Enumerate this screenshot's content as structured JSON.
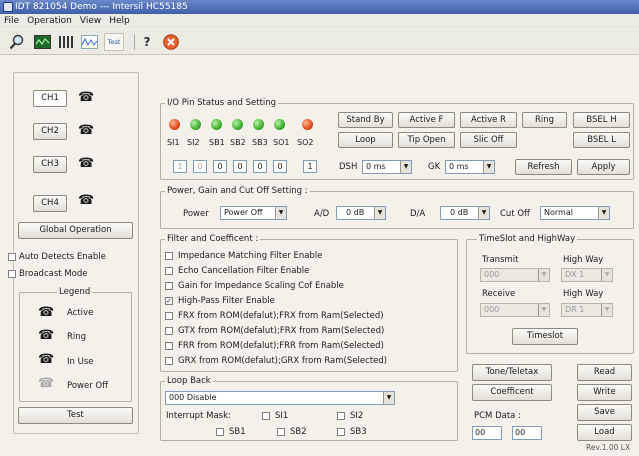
{
  "window": {
    "title": "IDT 821054 Demo --- Intersil HC55185"
  },
  "menu": [
    "File",
    "Operation",
    "View",
    "Help"
  ],
  "toolbar": {
    "test_label": "Test"
  },
  "icons": {
    "search": "magnifier-icon",
    "scope": "oscilloscope-icon",
    "bars": "bars-icon",
    "wave": "waveform-icon",
    "help": "help-icon",
    "exit": "exit-icon",
    "phone": "telephone-icon"
  },
  "colors": {
    "accent": "#3f5fa9",
    "led_red": "#e34a1c",
    "led_green": "#3fae2c"
  },
  "channels": [
    "CH1",
    "CH2",
    "CH3",
    "CH4"
  ],
  "left": {
    "global_operation": "Global Operation",
    "auto_detects": "Auto Detects Enable",
    "broadcast": "Broadcast Mode",
    "legend_title": "Legend",
    "legend": [
      "Active",
      "Ring",
      "In Use",
      "Power Off"
    ],
    "test": "Test"
  },
  "io": {
    "title": "I/O Pin Status and Setting",
    "pins": [
      "SI1",
      "SI2",
      "SB1",
      "SB2",
      "SB3",
      "SO1",
      "SO2"
    ],
    "pin_colors": [
      "#e34a1c",
      "#3fae2c",
      "#3fae2c",
      "#3fae2c",
      "#3fae2c",
      "#3fae2c",
      "#e34a1c"
    ],
    "buttons_row1": [
      "Stand By",
      "Active F",
      "Active R",
      "Ring",
      "BSEL H"
    ],
    "buttons_row2": [
      "Loop",
      "Tip Open",
      "Slic Off",
      "BSEL L"
    ],
    "bits": [
      "1",
      "0",
      "0",
      "0",
      "0",
      "0",
      "1"
    ],
    "dsh_label": "DSH",
    "dsh_value": "0 ms",
    "gk_label": "GK",
    "gk_value": "0 ms",
    "refresh": "Refresh",
    "apply": "Apply"
  },
  "power": {
    "title": "Power, Gain  and Cut Off Setting :",
    "power_label": "Power",
    "power_value": "Power Off",
    "ad_label": "A/D",
    "ad_value": "0 dB",
    "da_label": "D/A",
    "da_value": "0 dB",
    "cutoff_label": "Cut Off",
    "cutoff_value": "Normal"
  },
  "filter": {
    "title": "Filter and Coefficent :",
    "items": [
      {
        "label": "Impedance Matching Filter Enable",
        "checked": false
      },
      {
        "label": "Echo Cancellation Filter Enable",
        "checked": false
      },
      {
        "label": "Gain for Impedance Scaling Cof Enable",
        "checked": false
      },
      {
        "label": "High-Pass Filter Enable",
        "checked": true
      },
      {
        "label": "FRX from ROM(defalut);FRX from Ram(Selected)",
        "checked": false
      },
      {
        "label": "GTX from ROM(defalut);FRX from Ram(Selected)",
        "checked": false
      },
      {
        "label": "FRR from ROM(defalut);FRR from Ram(Selected)",
        "checked": false
      },
      {
        "label": "GRX from ROM(defalut);GRX from Ram(Selected)",
        "checked": false
      }
    ]
  },
  "timeslot": {
    "title": "TimeSlot and HighWay",
    "transmit": "Transmit",
    "receive": "Receive",
    "highway1": "High Way",
    "highway2": "High Way",
    "tx_value": "000",
    "tx_hw": "DX 1",
    "rx_value": "000",
    "rx_hw": "DR 1",
    "button": "Timeslot"
  },
  "loopback": {
    "title": "Loop Back",
    "value": "000 Disable",
    "interrupt_label": "Interrupt Mask:",
    "masks": [
      "SI1",
      "SI2",
      "SB1",
      "SB2",
      "SB3"
    ]
  },
  "right": {
    "tone": "Tone/Teletax",
    "coefficent": "Coefficent",
    "read": "Read",
    "write": "Write",
    "save": "Save",
    "load": "Load",
    "pcm_label": "PCM Data :",
    "pcm1": "00",
    "pcm2": "00",
    "version": "Rev.1.00 LX"
  }
}
